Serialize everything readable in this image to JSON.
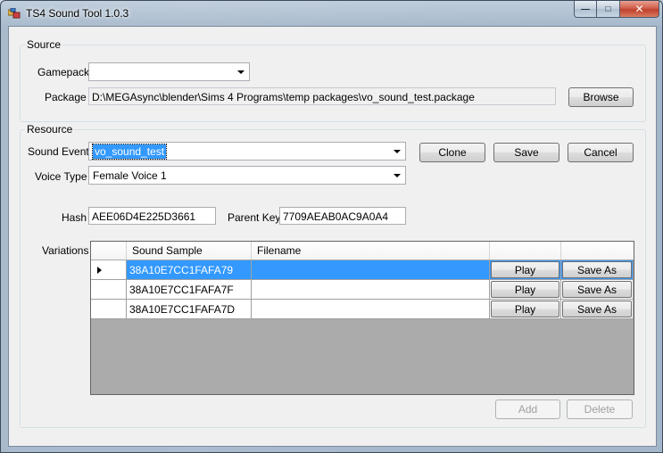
{
  "window": {
    "title": "TS4 Sound Tool 1.0.3",
    "minimize_glyph": "—",
    "maximize_glyph": "□",
    "close_glyph": "✕"
  },
  "source": {
    "group_label": "Source",
    "gamepack_label": "Gamepack",
    "gamepack_value": "",
    "package_label": "Package",
    "package_path": "D:\\MEGAsync\\blender\\Sims 4 Programs\\temp packages\\vo_sound_test.package",
    "browse_label": "Browse"
  },
  "resource": {
    "group_label": "Resource",
    "sound_event_label": "Sound Event",
    "sound_event_value": "vo_sound_test",
    "voice_type_label": "Voice Type",
    "voice_type_value": "Female Voice 1",
    "clone_label": "Clone",
    "save_label": "Save",
    "cancel_label": "Cancel",
    "hash_label": "Hash",
    "hash_value": "AEE06D4E225D3661",
    "parent_key_label": "Parent Key",
    "parent_key_value": "7709AEAB0AC9A0A4",
    "variations_label": "Variations",
    "add_label": "Add",
    "delete_label": "Delete"
  },
  "grid": {
    "columns": [
      "Sound Sample",
      "Filename",
      "",
      ""
    ],
    "rows": [
      {
        "sample": "38A10E7CC1FAFA79",
        "filename": "",
        "play": "Play",
        "save_as": "Save As",
        "selected": true
      },
      {
        "sample": "38A10E7CC1FAFA7F",
        "filename": "",
        "play": "Play",
        "save_as": "Save As",
        "selected": false
      },
      {
        "sample": "38A10E7CC1FAFA7D",
        "filename": "",
        "play": "Play",
        "save_as": "Save As",
        "selected": false
      }
    ]
  },
  "colors": {
    "selection": "#3399ff",
    "grid_background": "#ababab",
    "client_background": "#f0f0f0"
  }
}
